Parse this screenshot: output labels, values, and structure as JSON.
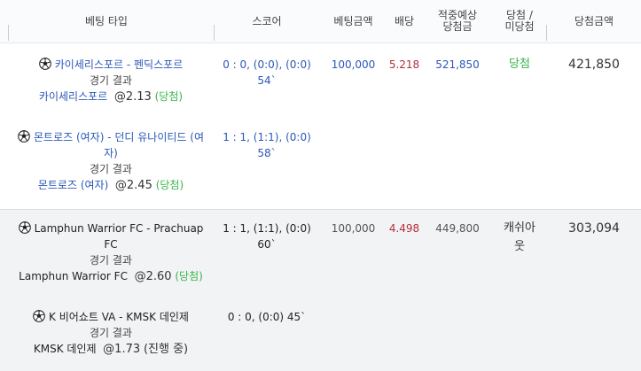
{
  "headers": {
    "bet_type": "베팅 타입",
    "score": "스코어",
    "bet_amount": "베팅금액",
    "odds": "배당",
    "expected_line1": "적중예상",
    "expected_line2": "당첨금",
    "result_line1": "당첨 /",
    "result_line2": "미당첨",
    "win_amount": "당첨금액"
  },
  "bets": [
    {
      "bet_amount": "100,000",
      "odds": "5.218",
      "expected": "521,850",
      "result": "당첨",
      "win_amount": "421,850",
      "selections": [
        {
          "match_line1": "카이세리스포르 - 펜딕스포르",
          "match_line2": "",
          "result_label": "경기 결과",
          "pick_team": "카이세리스포르",
          "pick_odd": "@2.13",
          "pick_status": "(당첨)",
          "score_line1": "0 : 0, (0:0), (0:0)",
          "score_line2": "54`"
        },
        {
          "match_line1": "몬트로즈 (여자) - 던디 유나이티드 (여",
          "match_line2": "자)",
          "result_label": "경기 결과",
          "pick_team": "몬트로즈 (여자)",
          "pick_odd": "@2.45",
          "pick_status": "(당첨)",
          "score_line1": "1 : 1, (1:1), (0:0)",
          "score_line2": "58`"
        }
      ]
    },
    {
      "bet_amount": "100,000",
      "odds": "4.498",
      "expected": "449,800",
      "result_line1": "캐쉬아",
      "result_line2": "웃",
      "win_amount": "303,094",
      "selections": [
        {
          "match_line1": "Lamphun Warrior FC - Prachuap",
          "match_line2": "FC",
          "result_label": "경기 결과",
          "pick_team": "Lamphun Warrior FC",
          "pick_odd": "@2.60",
          "pick_status": "(당첨)",
          "score_line1": "1 : 1, (1:1), (0:0)",
          "score_line2": "60`"
        },
        {
          "match_line1": "K 비어쇼트 VA - KMSK 데인제",
          "match_line2": "",
          "result_label": "경기 결과",
          "pick_team": "KMSK 데인제",
          "pick_odd": "@1.73",
          "pick_status": "(진행 중)",
          "score_line1": "0 : 0, (0:0) 45`",
          "score_line2": ""
        }
      ]
    }
  ],
  "icons": {
    "ball": "soccer-ball-icon"
  }
}
